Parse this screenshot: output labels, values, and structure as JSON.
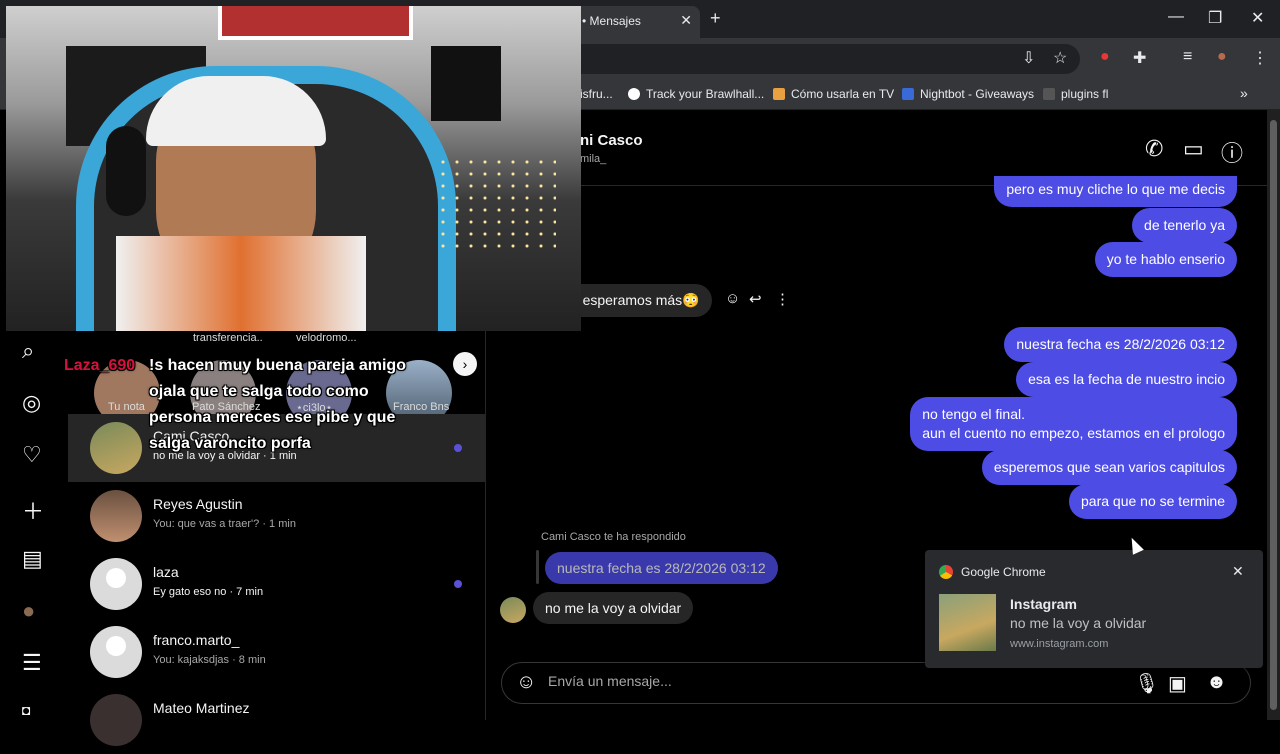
{
  "browser": {
    "tab_title": "• Mensajes",
    "bookmarks": [
      "isfru...",
      "Track your Brawlhall...",
      "Cómo usarla en TV",
      "Nightbot - Giveaways",
      "plugins fl"
    ]
  },
  "notes": {
    "top_labels": [
      "transferencia..",
      "velodromo..."
    ],
    "names": [
      "Tu nota",
      "Pato Sánchez",
      "⋆ci3lo⋆",
      "Franco Bns"
    ]
  },
  "conversations": [
    {
      "name": "Cami Casco",
      "preview": "no me la voy a olvidar · 1 min",
      "unread": true
    },
    {
      "name": "Reyes Agustin",
      "preview": "You: que vas a traer'? · 1 min",
      "unread": false
    },
    {
      "name": "laza",
      "preview": "Ey gato eso no · 7 min",
      "unread": true
    },
    {
      "name": "franco.marto_",
      "preview": "You: kajaksdjas · 8 min",
      "unread": false
    },
    {
      "name": "Mateo Martinez",
      "preview": "",
      "unread": false
    }
  ],
  "chat": {
    "name": "ni Casco",
    "username": "mila_",
    "outgoing": [
      "pero es muy cliche lo que me decis",
      "de tenerlo ya",
      "yo te hablo enserio",
      "nuestra fecha es 28/2/2026 03:12",
      "esa es la fecha de nuestro incio",
      "no tengo el final.\naun el cuento no empezo, estamos en el prologo",
      "esperemos que sean varios capitulos",
      "para que no se termine"
    ],
    "incoming_partial": "o, esperamos más😳",
    "reply_label": "Cami Casco te ha respondido",
    "reply_quote": "nuestra fecha es 28/2/2026 03:12",
    "last_incoming": "no me la voy a olvidar",
    "composer_placeholder": "Envía un mensaje..."
  },
  "notification": {
    "app": "Google Chrome",
    "title": "Instagram",
    "body": "no me la voy a olvidar",
    "origin": "www.instagram.com"
  },
  "stream_chat": {
    "username": "Laza_690",
    "message": "!s hacen muy buena pareja amigo ojala que te salga todo como persona mereces ese pibe y que salga varoncito porfa"
  },
  "colors": {
    "outgoing_bubble": "#4d4ce5",
    "unread_dot": "#5b51d8",
    "chat_username": "#d6123c"
  }
}
